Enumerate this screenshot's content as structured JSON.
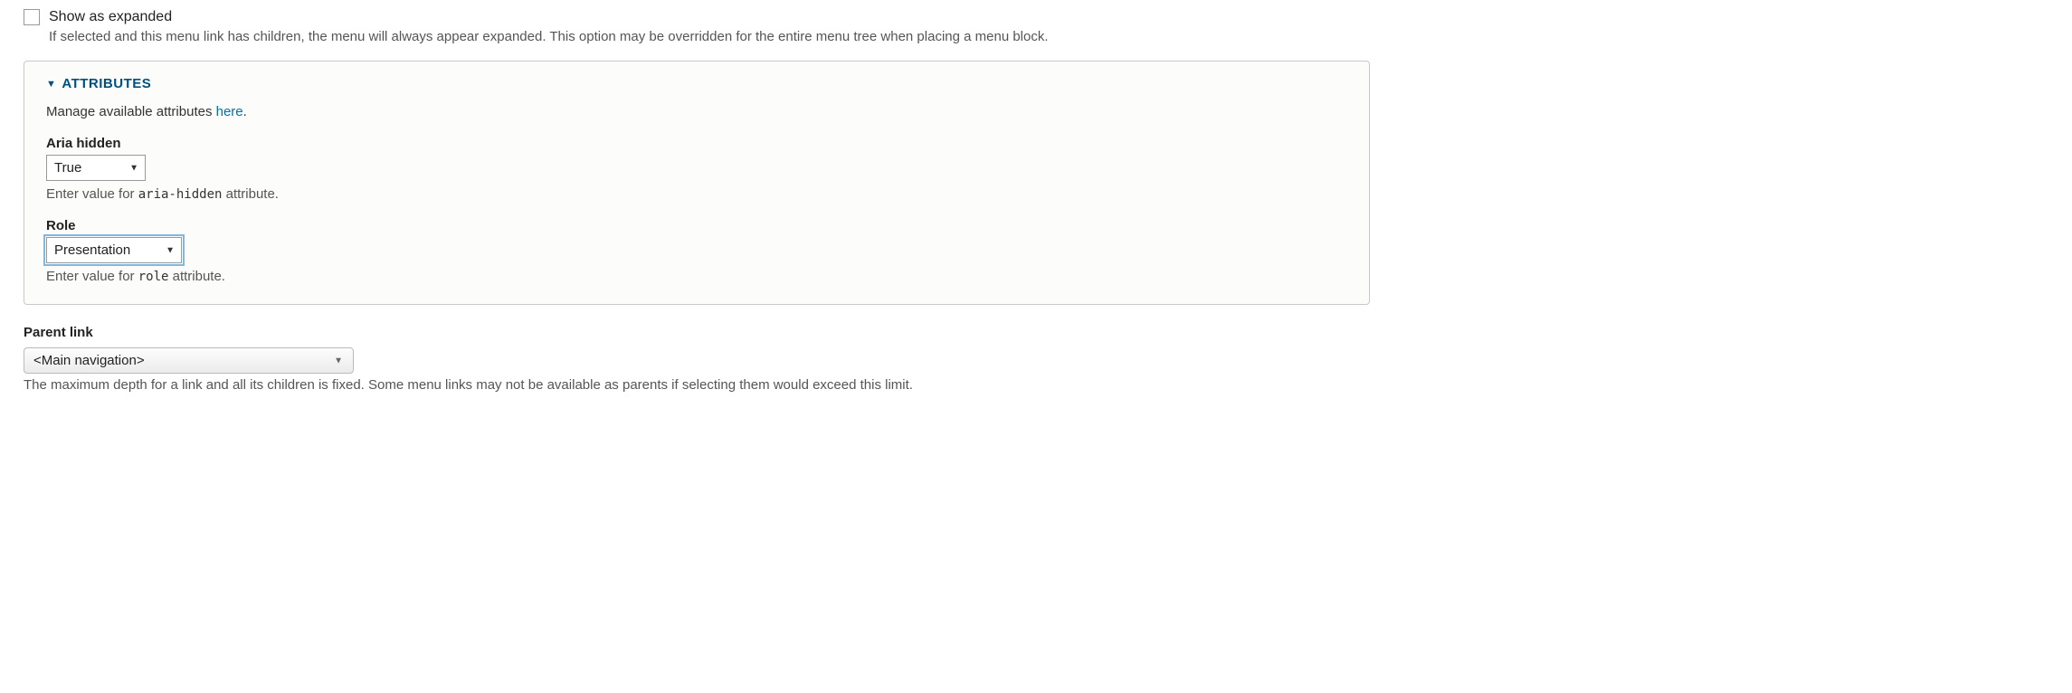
{
  "expanded_checkbox": {
    "label": "Show as expanded",
    "checked": false,
    "description": "If selected and this menu link has children, the menu will always appear expanded. This option may be overridden for the entire menu tree when placing a menu block."
  },
  "attributes": {
    "legend": "ATTRIBUTES",
    "intro_prefix": "Manage available attributes ",
    "intro_link": "here",
    "intro_suffix": ".",
    "aria_hidden": {
      "label": "Aria hidden",
      "value": "True",
      "helper_prefix": "Enter value for ",
      "helper_code": "aria-hidden",
      "helper_suffix": " attribute."
    },
    "role": {
      "label": "Role",
      "value": "Presentation",
      "helper_prefix": "Enter value for ",
      "helper_code": "role",
      "helper_suffix": " attribute."
    }
  },
  "parent_link": {
    "label": "Parent link",
    "value": "<Main navigation>",
    "description": "The maximum depth for a link and all its children is fixed. Some menu links may not be available as parents if selecting them would exceed this limit."
  }
}
